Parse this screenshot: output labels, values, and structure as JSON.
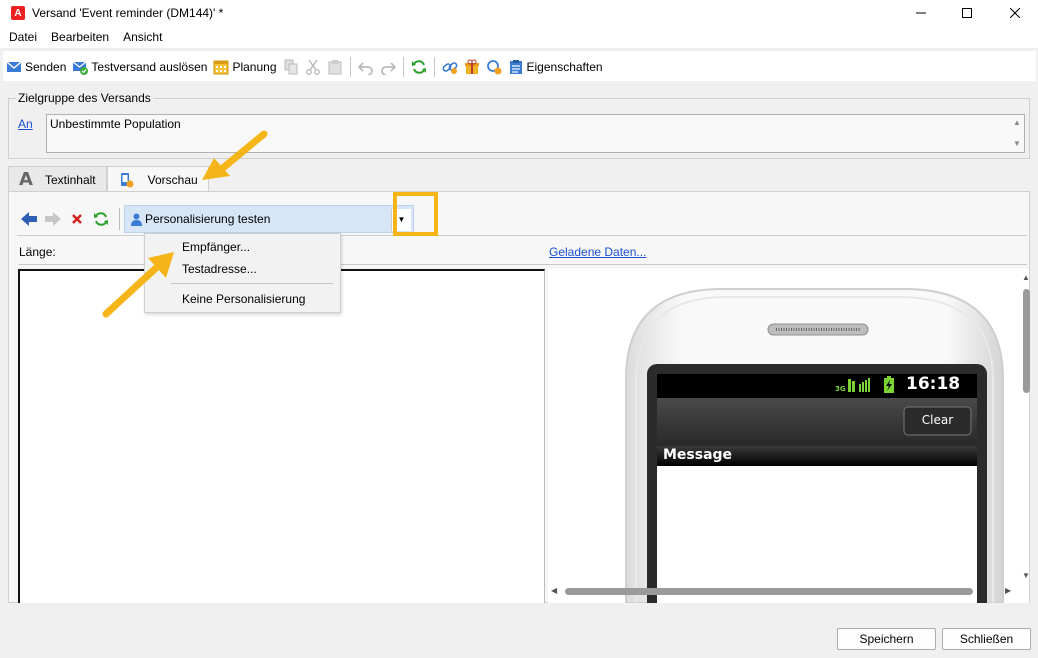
{
  "window": {
    "title": "Versand 'Event reminder (DM144)' *",
    "logo_letter": "A"
  },
  "menu": [
    "Datei",
    "Bearbeiten",
    "Ansicht"
  ],
  "toolbar": {
    "send": "Senden",
    "test_send": "Testversand auslösen",
    "schedule": "Planung",
    "properties": "Eigenschaften"
  },
  "target": {
    "legend": "Zielgruppe des Versands",
    "link": "An",
    "value": "Unbestimmte Population"
  },
  "tabs": {
    "text": "Textinhalt",
    "text_letter": "A",
    "preview": "Vorschau"
  },
  "preview": {
    "combo_label": "Personalisierung testen",
    "length_label": "Länge:",
    "loaded_data_link": "Geladene Daten..."
  },
  "dropdown": {
    "items": [
      "Empfänger...",
      "Testadresse...",
      "Keine Personalisierung"
    ]
  },
  "phone": {
    "network": "3G",
    "time": "16:18",
    "clear_button": "Clear",
    "message_header": "Message"
  },
  "footer": {
    "save": "Speichern",
    "close": "Schließen"
  },
  "colors": {
    "callout": "#f5b417",
    "link": "#1a4fcf",
    "combo_bg": "#d7e6f7"
  }
}
